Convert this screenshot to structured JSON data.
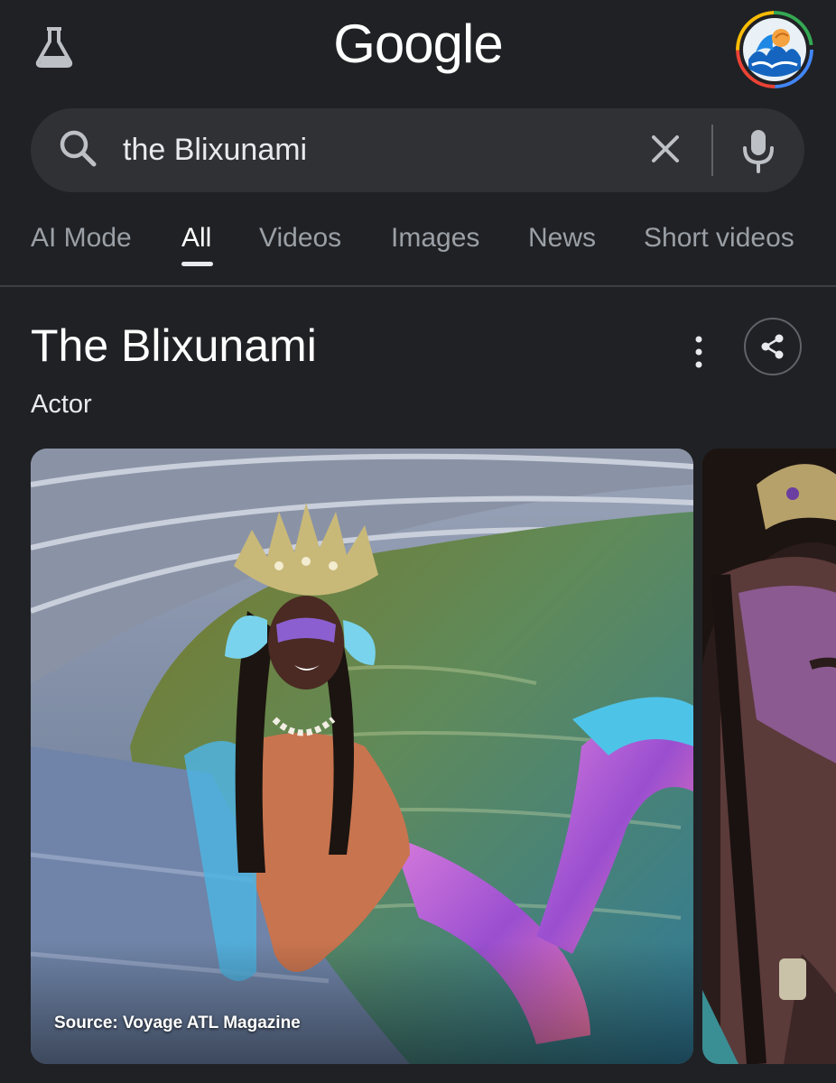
{
  "header": {
    "logo_text": "Google",
    "labs_icon": "flask-icon",
    "account_icon": "avatar-icon"
  },
  "search": {
    "query": "the Blixunami",
    "search_icon": "search-icon",
    "clear_icon": "close-icon",
    "mic_icon": "mic-icon"
  },
  "tabs": [
    {
      "label": "AI Mode",
      "active": false
    },
    {
      "label": "All",
      "active": true
    },
    {
      "label": "Videos",
      "active": false
    },
    {
      "label": "Images",
      "active": false
    },
    {
      "label": "News",
      "active": false
    },
    {
      "label": "Short videos",
      "active": false
    }
  ],
  "entity": {
    "title": "The Blixunami",
    "subtitle": "Actor",
    "more_icon": "more-vert-icon",
    "share_icon": "share-icon"
  },
  "images": {
    "main_source": "Source: Voyage ATL Magazine"
  },
  "colors": {
    "background": "#202124",
    "search_bar": "#303134",
    "text_primary": "#e8eaed",
    "text_secondary": "#9aa0a6",
    "divider": "#3c4043"
  }
}
